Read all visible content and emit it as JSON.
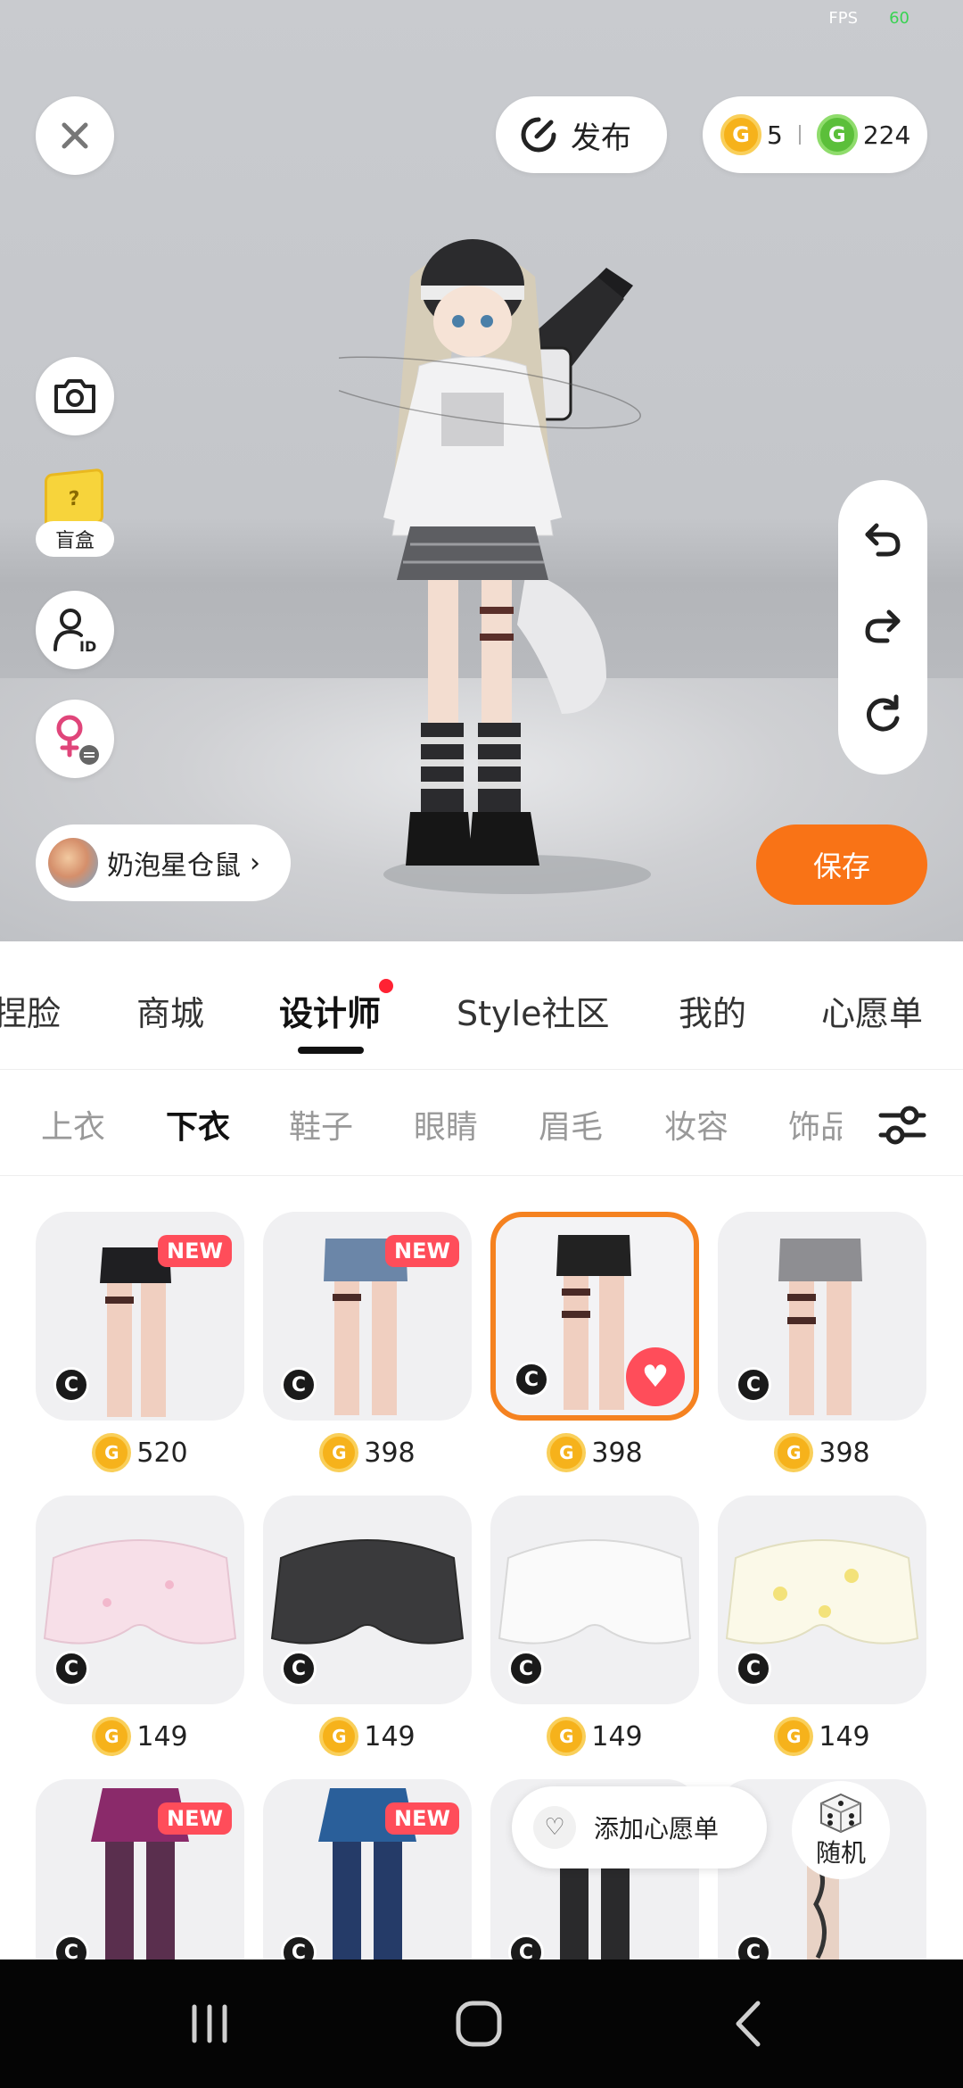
{
  "status": {
    "fps_label": "FPS",
    "fps_value": "60"
  },
  "top_bar": {
    "close_icon": "close-icon",
    "publish_label": "发布",
    "currency": {
      "gold_value": "5",
      "green_value": "224",
      "gold_symbol": "G",
      "green_symbol": "G"
    }
  },
  "left_tools": {
    "camera_icon": "camera-icon",
    "blindbox_label": "盲盒",
    "blindbox_symbol": "?",
    "id_icon": "user-id-icon",
    "gender_icon": "female-switch-icon"
  },
  "right_tools": {
    "undo": "undo-icon",
    "redo": "redo-icon",
    "reset": "reset-icon"
  },
  "creator": {
    "name": "奶泡星仓鼠",
    "chevron": "›"
  },
  "save_label": "保存",
  "main_tabs": [
    {
      "label": "捏脸"
    },
    {
      "label": "商城"
    },
    {
      "label": "设计师"
    },
    {
      "label": "Style社区"
    },
    {
      "label": "我的"
    },
    {
      "label": "心愿单"
    }
  ],
  "sub_tabs": [
    {
      "label": "上衣"
    },
    {
      "label": "下衣"
    },
    {
      "label": "鞋子"
    },
    {
      "label": "眼睛"
    },
    {
      "label": "眉毛"
    },
    {
      "label": "妆容"
    },
    {
      "label": "饰品"
    }
  ],
  "items": [
    {
      "price": "520",
      "new_badge": "NEW",
      "kind": "black-shorts"
    },
    {
      "price": "398",
      "new_badge": "NEW",
      "kind": "denim-shorts"
    },
    {
      "price": "398",
      "new_badge": "",
      "kind": "black-shorts-garter",
      "selected": true
    },
    {
      "price": "398",
      "new_badge": "",
      "kind": "grey-shorts-garter"
    },
    {
      "price": "149",
      "new_badge": "",
      "kind": "pink-bloomers"
    },
    {
      "price": "149",
      "new_badge": "",
      "kind": "black-bloomers"
    },
    {
      "price": "149",
      "new_badge": "",
      "kind": "white-bloomers"
    },
    {
      "price": "149",
      "new_badge": "",
      "kind": "yellow-bloomers"
    },
    {
      "price": "",
      "new_badge": "NEW",
      "kind": "plaid-skirt-purple"
    },
    {
      "price": "",
      "new_badge": "NEW",
      "kind": "plaid-skirt-blue"
    },
    {
      "price": "",
      "new_badge": "",
      "kind": "black-stockings"
    },
    {
      "price": "",
      "new_badge": "",
      "kind": "tattoo-legs"
    }
  ],
  "item_badge_symbol": "C",
  "wishlist_label": "添加心愿单",
  "random_label": "随机",
  "colors": {
    "accent": "#f97316",
    "new": "#ff4d5a",
    "selected_border": "#f58220"
  }
}
